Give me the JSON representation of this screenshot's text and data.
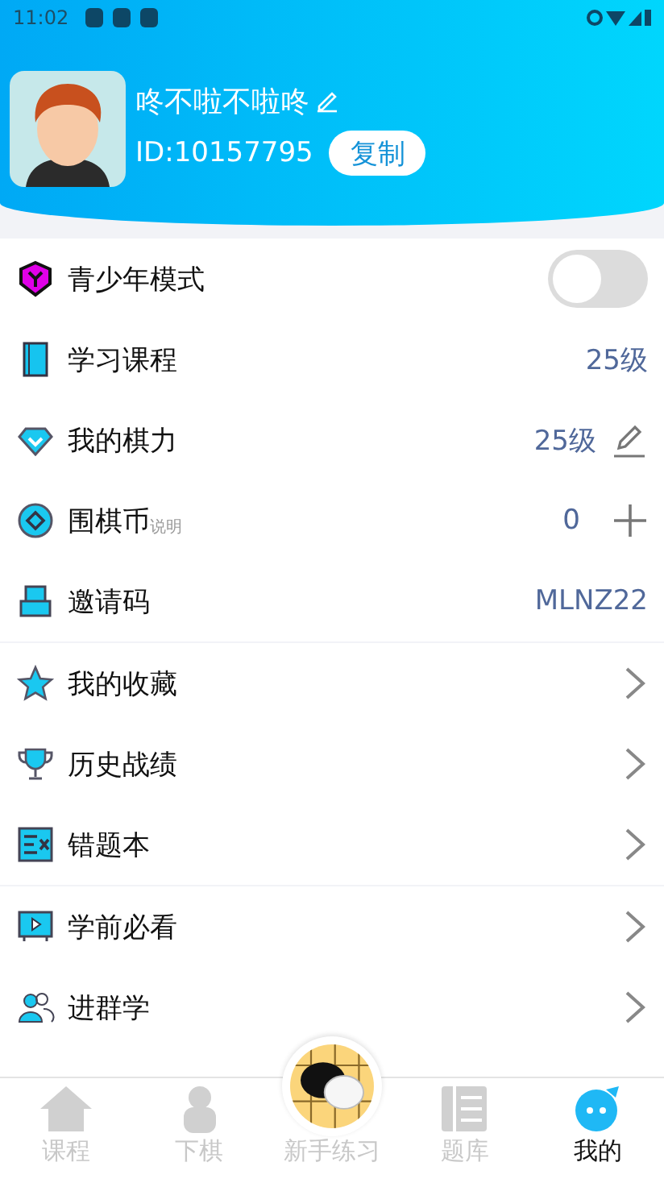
{
  "status_bar": {
    "time": "11:02"
  },
  "profile": {
    "name": "咚不啦不啦咚",
    "id": "ID:10157795",
    "copy_button": "复制"
  },
  "menu_groups": [
    {
      "items": [
        {
          "kind": "toggle",
          "label": "青少年模式",
          "on": false
        },
        {
          "kind": "value",
          "label": "学习课程",
          "value": "25级"
        },
        {
          "kind": "value_edit",
          "label": "我的棋力",
          "value": "25级"
        },
        {
          "kind": "value_add",
          "label": "围棋币",
          "note": "说明",
          "value": "0"
        },
        {
          "kind": "value",
          "label": "邀请码",
          "value": "MLNZ22"
        }
      ]
    },
    {
      "items": [
        {
          "kind": "link",
          "label": "我的收藏"
        },
        {
          "kind": "link",
          "label": "历史战绩"
        },
        {
          "kind": "link",
          "label": "错题本"
        }
      ]
    },
    {
      "items": [
        {
          "kind": "link",
          "label": "学前必看"
        },
        {
          "kind": "link",
          "label": "进群学"
        }
      ]
    }
  ],
  "tab_bar": [
    {
      "label": "课程",
      "selected": false
    },
    {
      "label": "下棋",
      "selected": false
    },
    {
      "label": "新手练习",
      "selected": false
    },
    {
      "label": "题库",
      "selected": false
    },
    {
      "label": "我的",
      "selected": true
    }
  ]
}
